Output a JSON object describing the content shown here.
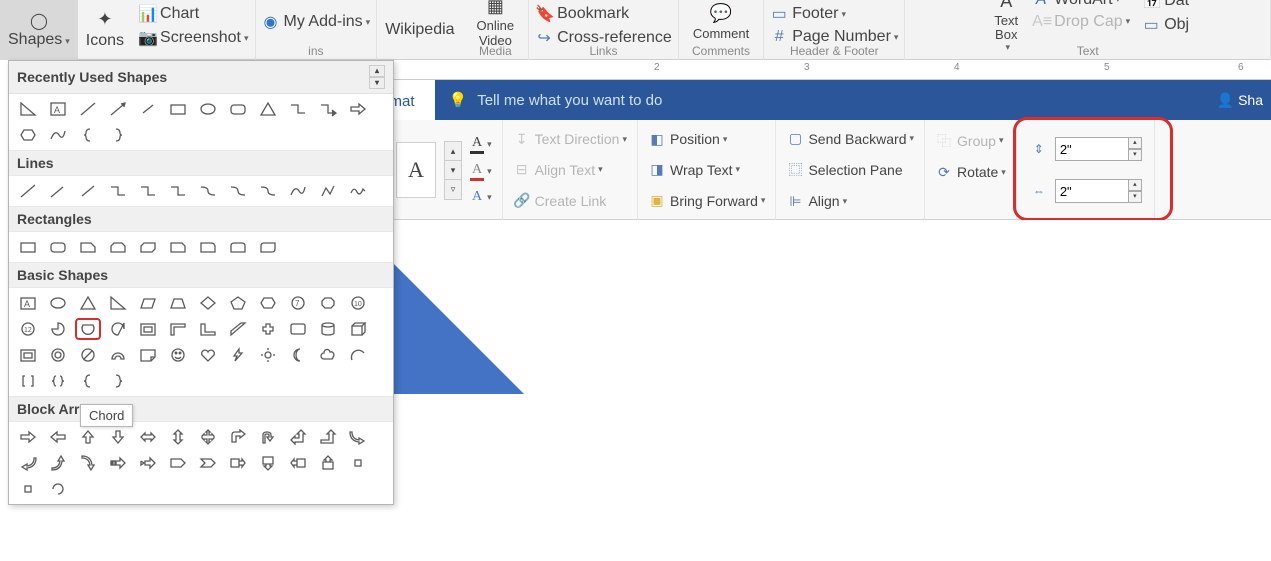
{
  "ribbon": {
    "shapes": "Shapes",
    "icons": "Icons",
    "chart": "Chart",
    "screenshot": "Screenshot",
    "addins": "My Add-ins",
    "wiki": "Wikipedia",
    "onlinevideo": "Online\nVideo",
    "bookmark": "Bookmark",
    "crossref": "Cross-reference",
    "comment": "Comment",
    "footer": "Footer",
    "pagenum": "Page Number",
    "textbox": "Text\nBox",
    "wordart": "WordArt",
    "dropcap": "Drop Cap",
    "date": "Dat",
    "obj": "Obj",
    "groups": {
      "media": "Media",
      "links": "Links",
      "comments": "Comments",
      "hf": "Header & Footer",
      "text": "Text",
      "addlabel": "ins"
    }
  },
  "format": {
    "tab": "Format",
    "tellme": "Tell me what you want to do",
    "share": "Sha",
    "textdir": "Text Direction",
    "aligntxt": "Align Text",
    "createlink": "Create Link",
    "position": "Position",
    "wrap": "Wrap Text",
    "bringfwd": "Bring Forward",
    "sendback": "Send Backward",
    "selpane": "Selection Pane",
    "align": "Align",
    "group": "Group",
    "rotate": "Rotate",
    "height": "2\"",
    "width": "2\""
  },
  "ruler": [
    "2",
    "3",
    "4",
    "5",
    "6"
  ],
  "panel": {
    "recent": "Recently Used Shapes",
    "lines": "Lines",
    "rect": "Rectangles",
    "basic": "Basic Shapes",
    "block": "Block Arrows",
    "tooltip": "Chord"
  }
}
